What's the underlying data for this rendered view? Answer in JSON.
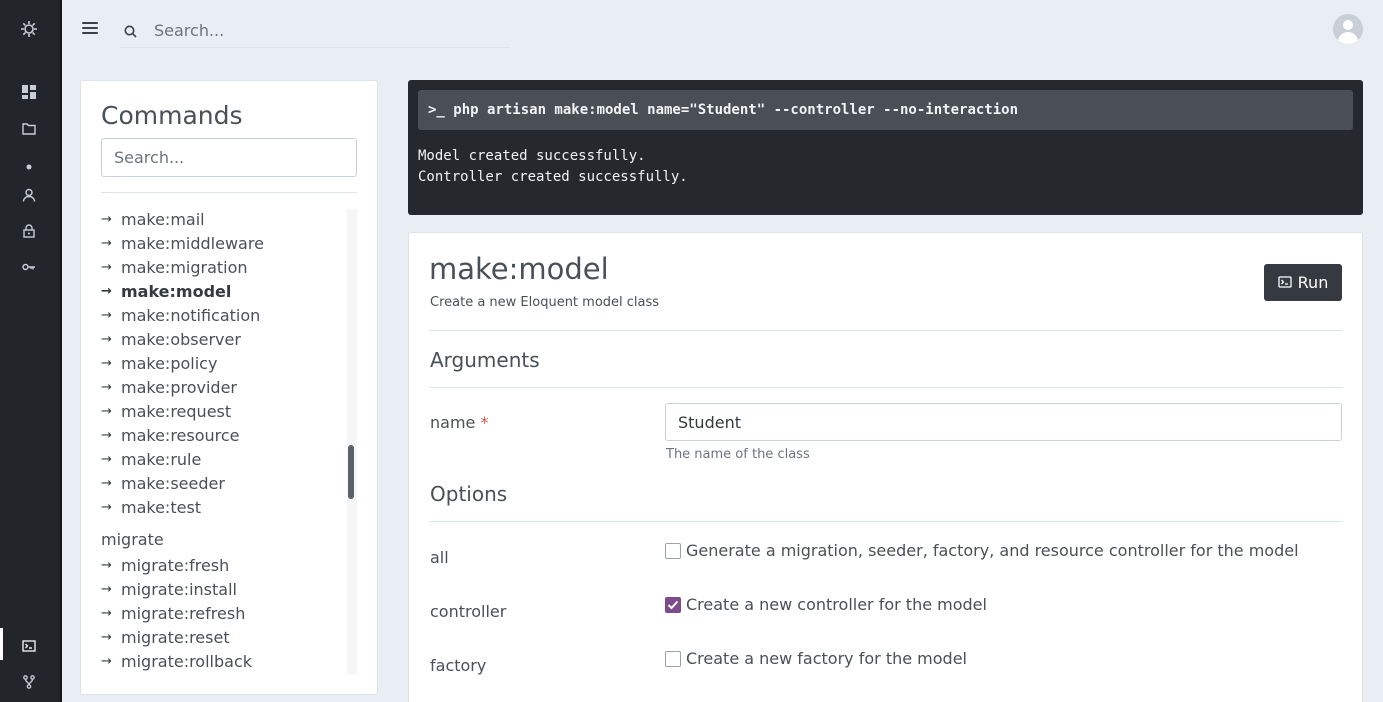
{
  "top_search": {
    "placeholder": "Search..."
  },
  "commands": {
    "title": "Commands",
    "search_placeholder": "Search...",
    "items": [
      {
        "arrow": "→",
        "label": "make:mail",
        "active": false
      },
      {
        "arrow": "→",
        "label": "make:middleware",
        "active": false
      },
      {
        "arrow": "→",
        "label": "make:migration",
        "active": false
      },
      {
        "arrow": "→",
        "label": "make:model",
        "active": true
      },
      {
        "arrow": "→",
        "label": "make:notification",
        "active": false
      },
      {
        "arrow": "→",
        "label": "make:observer",
        "active": false
      },
      {
        "arrow": "→",
        "label": "make:policy",
        "active": false
      },
      {
        "arrow": "→",
        "label": "make:provider",
        "active": false
      },
      {
        "arrow": "→",
        "label": "make:request",
        "active": false
      },
      {
        "arrow": "→",
        "label": "make:resource",
        "active": false
      },
      {
        "arrow": "→",
        "label": "make:rule",
        "active": false
      },
      {
        "arrow": "→",
        "label": "make:seeder",
        "active": false
      },
      {
        "arrow": "→",
        "label": "make:test",
        "active": false
      }
    ],
    "group2": {
      "title": "migrate",
      "items": [
        {
          "arrow": "→",
          "label": "migrate:fresh"
        },
        {
          "arrow": "→",
          "label": "migrate:install"
        },
        {
          "arrow": "→",
          "label": "migrate:refresh"
        },
        {
          "arrow": "→",
          "label": "migrate:reset"
        },
        {
          "arrow": "→",
          "label": "migrate:rollback"
        }
      ]
    }
  },
  "terminal": {
    "command": ">_ php artisan make:model name=\"Student\" --controller --no-interaction",
    "output": [
      "Model created successfully.",
      "Controller created successfully."
    ]
  },
  "detail": {
    "title": "make:model",
    "description": "Create a new Eloquent model class",
    "run_label": "Run",
    "arguments_title": "Arguments",
    "name_label": "name",
    "required_mark": "*",
    "name_value": "Student",
    "name_help": "The name of the class",
    "options_title": "Options",
    "options": [
      {
        "key": "all",
        "description": "Generate a migration, seeder, factory, and resource controller for the model",
        "checked": false
      },
      {
        "key": "controller",
        "description": "Create a new controller for the model",
        "checked": true
      },
      {
        "key": "factory",
        "description": "Create a new factory for the model",
        "checked": false
      }
    ]
  },
  "colors": {
    "rail": "#22262b",
    "accent_checkbox": "#7d4a8a",
    "terminal_bg": "#25292e",
    "run_button": "#343a40"
  }
}
